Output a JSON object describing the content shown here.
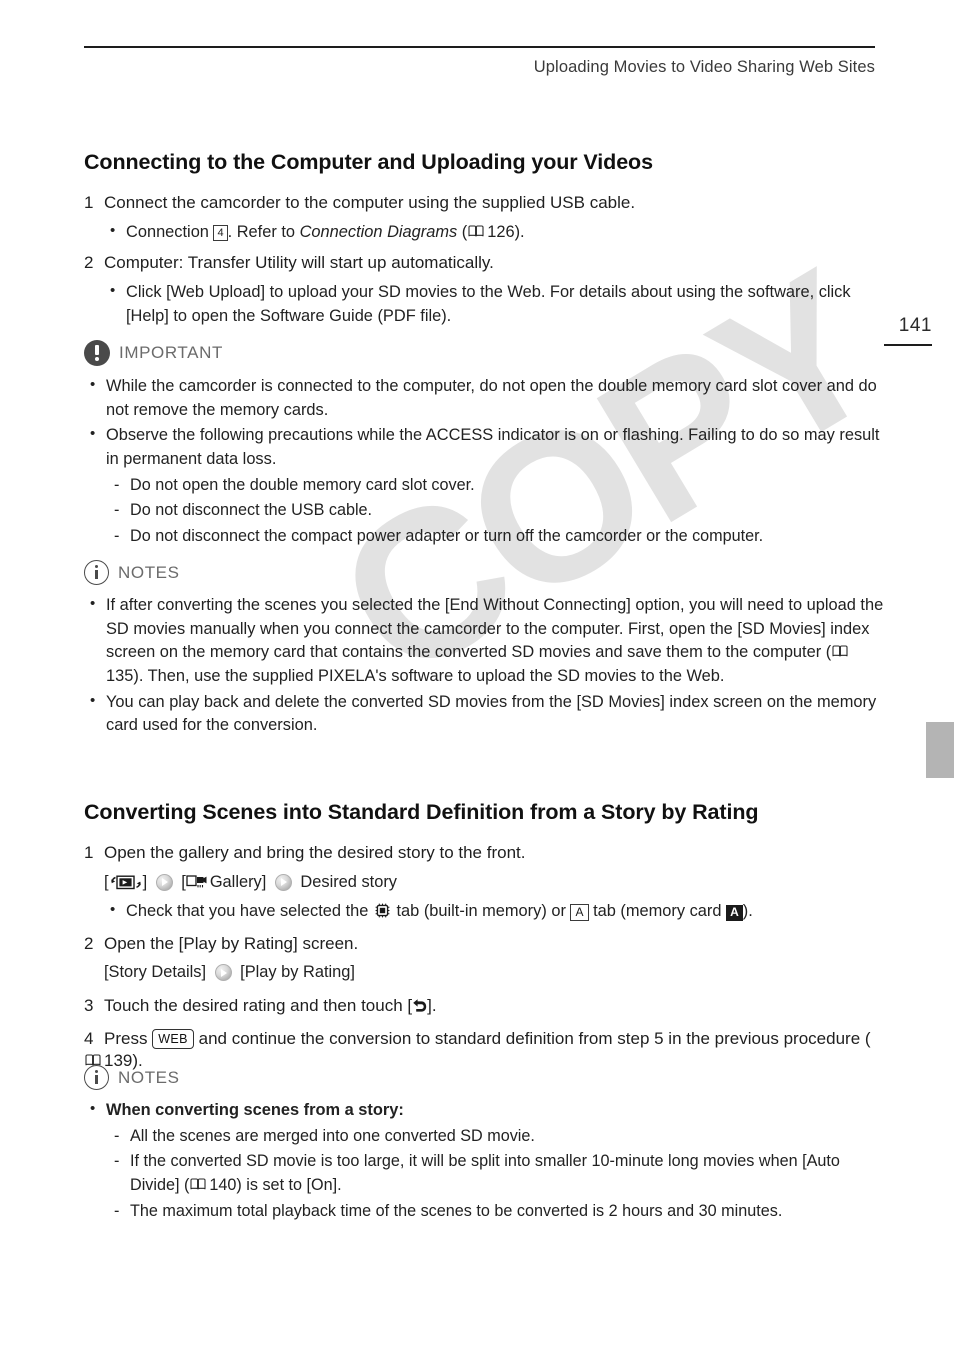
{
  "header": {
    "running_title": "Uploading Movies to Video Sharing Web Sites",
    "page_number": "141"
  },
  "watermark": {
    "text": "COPY"
  },
  "section1": {
    "heading": "Connecting to the Computer and Uploading your Videos",
    "step1": {
      "number": "1",
      "text": "Connect the camcorder to the computer using the supplied USB cable.",
      "bullet_pre": "Connection",
      "bullet_box": "4",
      "bullet_mid": ". Refer to",
      "bullet_italic": "Connection Diagrams",
      "bullet_paren_open": "(",
      "bullet_page": "126",
      "bullet_paren_close": ")."
    },
    "step2": {
      "number": "2",
      "text": "Computer: Transfer Utility will start up automatically.",
      "bullet": "Click [Web Upload] to upload your SD movies to the Web. For details about using the software, click [Help] to open the Software Guide (PDF file)."
    }
  },
  "important": {
    "label": "IMPORTANT",
    "bullets": [
      "While the camcorder is connected to the computer, do not open the double memory card slot cover and do not remove the memory cards.",
      "Observe the following precautions while the ACCESS indicator is on or flashing. Failing to do so may result in permanent data loss."
    ],
    "sub_items": [
      "Do not open the double memory card slot cover.",
      "Do not disconnect the USB cable.",
      "Do not disconnect the compact power adapter or turn off the camcorder or the computer."
    ]
  },
  "notes1": {
    "label": "NOTES",
    "bullet1_a": "If after converting the scenes you selected the [End Without Connecting] option, you will need to upload the SD movies manually when you connect the camcorder to the computer. First, open the [SD Movies] index screen on the memory card that contains the converted SD movies and save them to the computer (",
    "bullet1_page": "135",
    "bullet1_b": "). Then, use the supplied PIXELA's software to upload the SD movies to the Web.",
    "bullet2": "You can play back and delete the converted SD movies from the [SD Movies] index screen on the memory card used for the conversion."
  },
  "section2": {
    "heading": "Converting Scenes into Standard Definition from a Story by Rating",
    "step1": {
      "number": "1",
      "text": "Open the gallery and bring the desired story to the front.",
      "path_open": "[",
      "path_close": "]",
      "path_gallery_open": "[",
      "path_gallery_label": "Gallery]",
      "path_desired": "Desired story",
      "check_pre": "Check that you have selected the",
      "check_mid": "tab (built-in memory) or",
      "check_mid2": "tab (memory card",
      "check_A_outline": "A",
      "check_A_solid": "A",
      "check_end": ")."
    },
    "step2": {
      "number": "2",
      "text": "Open the [Play by Rating] screen.",
      "path_a": "[Story Details]",
      "path_b": "[Play by Rating]"
    },
    "step3": {
      "number": "3",
      "text_pre": "Touch the desired rating and then touch [",
      "text_post": "]."
    },
    "step4": {
      "number": "4",
      "text_pre": "Press",
      "button_label": "WEB",
      "text_mid": "and continue the conversion to standard definition from step 5 in the previous procedure (",
      "page": "139",
      "text_end": ")."
    }
  },
  "notes2": {
    "label": "NOTES",
    "bullet_bold": "When converting scenes from a story:",
    "sub1": "All the scenes are merged into one converted SD movie.",
    "sub2_a": "If the converted SD movie is too large, it will be split into smaller 10-minute long movies when [Auto Divide] (",
    "sub2_page": "140",
    "sub2_b": ") is set to [On].",
    "sub3": "The maximum total playback time of the scenes to be converted is 2 hours and 30 minutes."
  },
  "colors": {
    "text": "#1a1a1a",
    "muted": "#6b6b6b",
    "rule": "#1d1d1d",
    "side_tab": "#b4b4b4",
    "watermark": "#e2e2e2"
  }
}
